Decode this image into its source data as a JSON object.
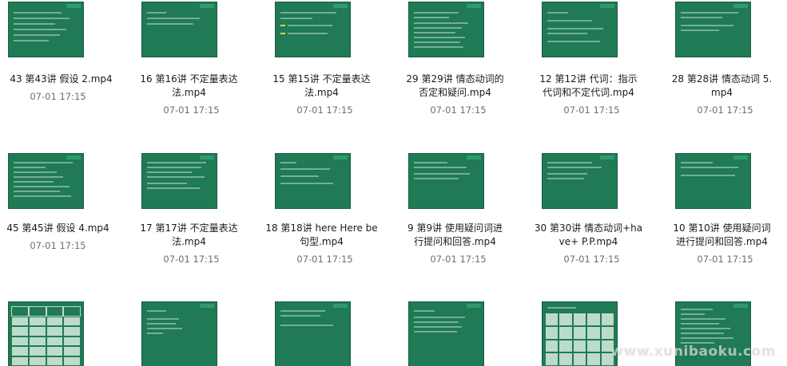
{
  "files": [
    {
      "name_line1": "43 第43讲 假设 2.mp4",
      "name_line2": "",
      "date": "07-01 17:15"
    },
    {
      "name_line1": "16 第16讲 不定量表达",
      "name_line2": "法.mp4",
      "date": "07-01 17:15"
    },
    {
      "name_line1": "15 第15讲 不定量表达",
      "name_line2": "法.mp4",
      "date": "07-01 17:15"
    },
    {
      "name_line1": "29 第29讲 情态动词的",
      "name_line2": "否定和疑问.mp4",
      "date": "07-01 17:15"
    },
    {
      "name_line1": "12 第12讲 代词：指示",
      "name_line2": "代词和不定代词.mp4",
      "date": "07-01 17:15"
    },
    {
      "name_line1": "28 第28讲 情态动词 5.",
      "name_line2": "mp4",
      "date": "07-01 17:15"
    },
    {
      "name_line1": "45 第45讲 假设 4.mp4",
      "name_line2": "",
      "date": "07-01 17:15"
    },
    {
      "name_line1": "17 第17讲 不定量表达",
      "name_line2": "法.mp4",
      "date": "07-01 17:15"
    },
    {
      "name_line1": "18 第18讲 here Here be",
      "name_line2": "句型.mp4",
      "date": "07-01 17:15"
    },
    {
      "name_line1": "9 第9讲 使用疑问词进",
      "name_line2": "行提问和回答.mp4",
      "date": "07-01 17:15"
    },
    {
      "name_line1": "30 第30讲 情态动词+ha",
      "name_line2": "ve+ P.P.mp4",
      "date": "07-01 17:15"
    },
    {
      "name_line1": "10 第10讲 使用疑问词",
      "name_line2": "进行提问和回答.mp4",
      "date": "07-01 17:15"
    }
  ],
  "watermark": "www.xunibaoku.com",
  "colors": {
    "thumb_green": "#1f7a55",
    "highlight_yellow": "#e3d04a",
    "date_gray": "#6e6e6e"
  }
}
